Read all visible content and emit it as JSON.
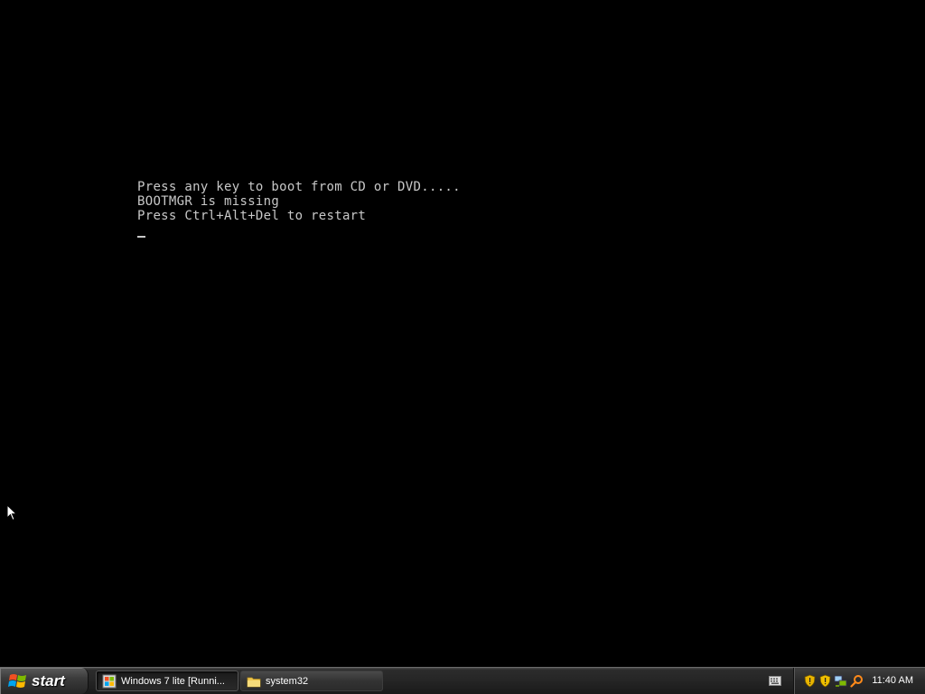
{
  "console": {
    "lines": [
      "Press any key to boot from CD or DVD.....",
      "BOOTMGR is missing",
      "Press Ctrl+Alt+Del to restart"
    ]
  },
  "taskbar": {
    "start_label": "start",
    "tasks": [
      {
        "label": "Windows 7 lite [Runni...",
        "icon": "virtualbox-window-icon",
        "active": true
      },
      {
        "label": "system32",
        "icon": "folder-icon",
        "active": false
      }
    ],
    "tray_icons": [
      "language-bar-icon",
      "security-shield-icon",
      "security-shield-icon",
      "network-icon",
      "search-icon"
    ],
    "clock": "11:40 AM"
  },
  "colors": {
    "console_text": "#c8c8c8",
    "background": "#000000",
    "taskbar": "#262626"
  }
}
